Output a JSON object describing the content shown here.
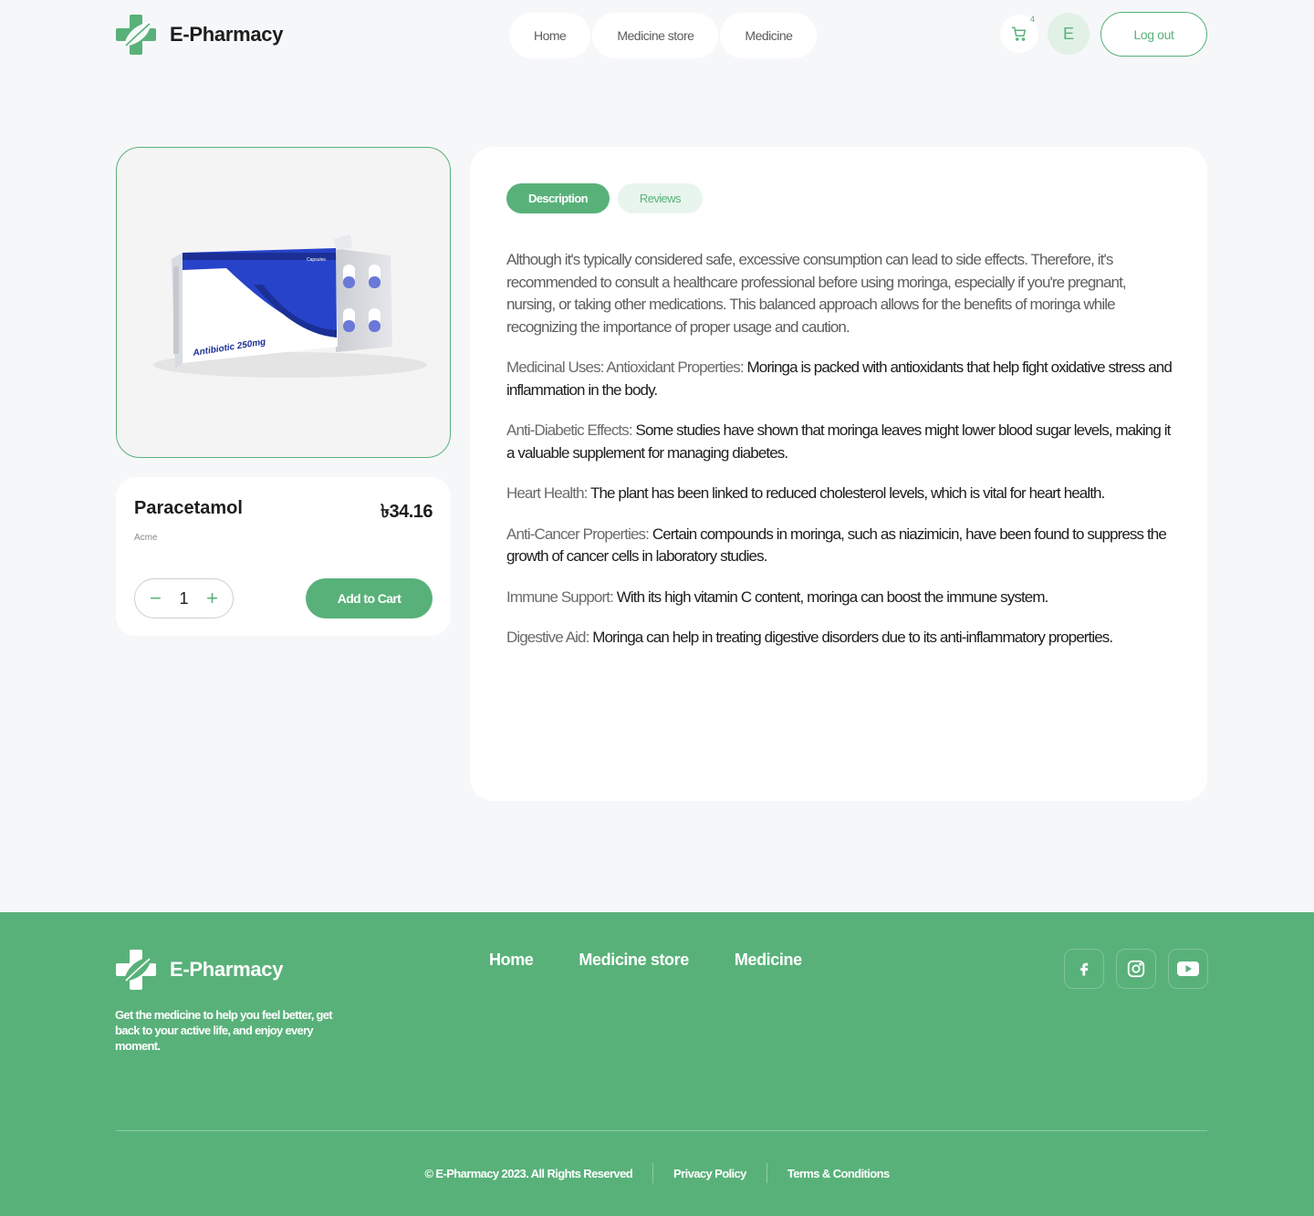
{
  "brand": {
    "name": "E-Pharmacy",
    "accent": "#59b17a"
  },
  "header": {
    "nav": [
      "Home",
      "Medicine store",
      "Medicine"
    ],
    "cart_count": "4",
    "avatar_letter": "E",
    "logout_label": "Log out"
  },
  "product": {
    "name": "Paracetamol",
    "price": "৳34.16",
    "brand": "Acme",
    "quantity": "1",
    "add_to_cart_label": "Add to Cart",
    "image_text": {
      "box_label": "Antibiotic 250mg",
      "box_small": "Capsules"
    }
  },
  "description": {
    "tabs": [
      {
        "label": "Description",
        "active": true
      },
      {
        "label": "Reviews",
        "active": false
      }
    ],
    "intro": "Although it's typically considered safe, excessive consumption can lead to side effects. Therefore, it's recommended to consult a healthcare professional before using moringa, especially if you're pregnant, nursing, or taking other medications. This balanced approach allows for the benefits of moringa while recognizing the importance of proper usage and caution.",
    "items": [
      {
        "label": "Medicinal Uses: Antioxidant Properties:",
        "text": "Moringa is packed with antioxidants that help fight oxidative stress and inflammation in the body."
      },
      {
        "label": "Anti-Diabetic Effects:",
        "text": "Some studies have shown that moringa leaves might lower blood sugar levels, making it a valuable supplement for managing diabetes."
      },
      {
        "label": "Heart Health:",
        "text": "The plant has been linked to reduced cholesterol levels, which is vital for heart health."
      },
      {
        "label": "Anti-Cancer Properties:",
        "text": "Certain compounds in moringa, such as niazimicin, have been found to suppress the growth of cancer cells in laboratory studies."
      },
      {
        "label": "Immune Support:",
        "text": "With its high vitamin C content, moringa can boost the immune system."
      },
      {
        "label": "Digestive Aid:",
        "text": "Moringa can help in treating digestive disorders due to its anti-inflammatory properties."
      }
    ]
  },
  "footer": {
    "tagline": "Get the medicine to help you feel better, get back to your active life, and enjoy every moment.",
    "nav": [
      "Home",
      "Medicine store",
      "Medicine"
    ],
    "socials": [
      "facebook-icon",
      "instagram-icon",
      "youtube-icon"
    ],
    "copyright": "© E-Pharmacy 2023. All Rights Reserved",
    "privacy": "Privacy Policy",
    "terms": "Terms & Conditions"
  }
}
